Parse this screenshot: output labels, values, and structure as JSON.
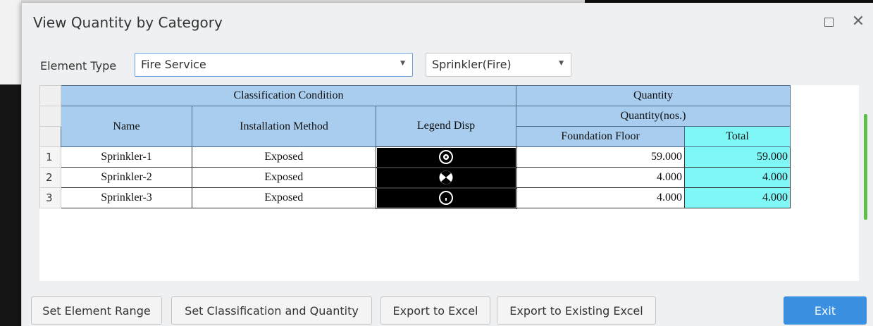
{
  "window": {
    "title": "View Quantity by Category",
    "maximize_icon": "maximize-icon",
    "close_symbol": "✕"
  },
  "filters": {
    "element_type_label": "Element Type",
    "element_type_value": "Fire Service",
    "subtype_value": "Sprinkler(Fire)"
  },
  "table": {
    "group_headers": {
      "classification": "Classification Condition",
      "quantity": "Quantity"
    },
    "columns": {
      "name": "Name",
      "installation_method": "Installation Method",
      "legend_disp": "Legend Disp",
      "quantity_unit": "Quantity(nos.)",
      "foundation_floor": "Foundation Floor",
      "total": "Total"
    },
    "rows": [
      {
        "index": "1",
        "name": "Sprinkler-1",
        "method": "Exposed",
        "legend_icon": "sprinkler-symbol-1",
        "foundation_floor": "59.000",
        "total": "59.000"
      },
      {
        "index": "2",
        "name": "Sprinkler-2",
        "method": "Exposed",
        "legend_icon": "sprinkler-symbol-2",
        "foundation_floor": "4.000",
        "total": "4.000"
      },
      {
        "index": "3",
        "name": "Sprinkler-3",
        "method": "Exposed",
        "legend_icon": "sprinkler-symbol-3",
        "foundation_floor": "4.000",
        "total": "4.000"
      }
    ]
  },
  "buttons": {
    "set_element_range": "Set Element Range",
    "set_classification": "Set Classification and Quantity",
    "export_excel": "Export to Excel",
    "export_existing": "Export to Existing Excel",
    "exit": "Exit"
  },
  "colors": {
    "header_bg": "#a9cdee",
    "total_bg": "#7ff7f7",
    "exit_button": "#3b8fe0",
    "scrollbar": "#5cbf4a"
  }
}
